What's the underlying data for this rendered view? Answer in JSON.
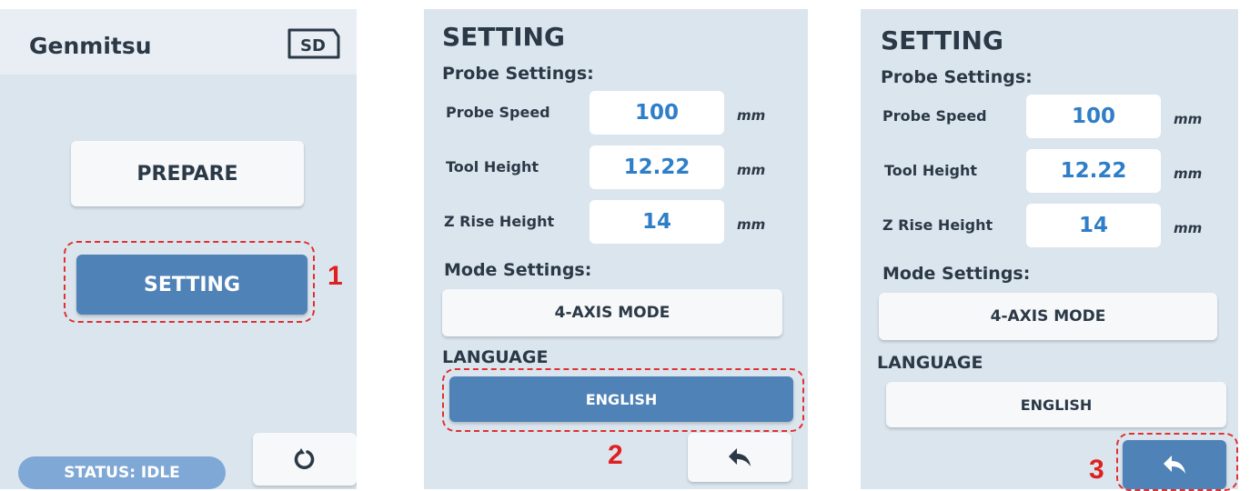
{
  "panel1": {
    "brand": "Genmitsu",
    "sd_label": "SD",
    "prepare_label": "PREPARE",
    "setting_label": "SETTING",
    "status_text": "STATUS: IDLE",
    "reset_icon": "refresh-icon",
    "callout_number": "1"
  },
  "panel2": {
    "title": "SETTING",
    "probe_section": "Probe Settings:",
    "rows": [
      {
        "label": "Probe Speed",
        "value": "100",
        "unit": "mm"
      },
      {
        "label": "Tool Height",
        "value": "12.22",
        "unit": "mm"
      },
      {
        "label": "Z Rise Height",
        "value": "14",
        "unit": "mm"
      }
    ],
    "mode_section": "Mode Settings:",
    "mode_value": "4-AXIS MODE",
    "language_section": "LANGUAGE",
    "language_value": "ENGLISH",
    "back_icon": "back-arrow-icon",
    "callout_number": "2"
  },
  "panel3": {
    "title": "SETTING",
    "probe_section": "Probe Settings:",
    "rows": [
      {
        "label": "Probe Speed",
        "value": "100",
        "unit": "mm"
      },
      {
        "label": "Tool Height",
        "value": "12.22",
        "unit": "mm"
      },
      {
        "label": "Z Rise Height",
        "value": "14",
        "unit": "mm"
      }
    ],
    "mode_section": "Mode Settings:",
    "mode_value": "4-AXIS MODE",
    "language_section": "LANGUAGE",
    "language_value": "ENGLISH",
    "back_icon": "back-arrow-icon",
    "callout_number": "3"
  },
  "colors": {
    "panel_bg": "#dbe5ee",
    "accent_blue": "#4f82b7",
    "value_blue": "#2f7ec8",
    "callout_red": "#e02020",
    "status_blue": "#7fa8d6"
  }
}
